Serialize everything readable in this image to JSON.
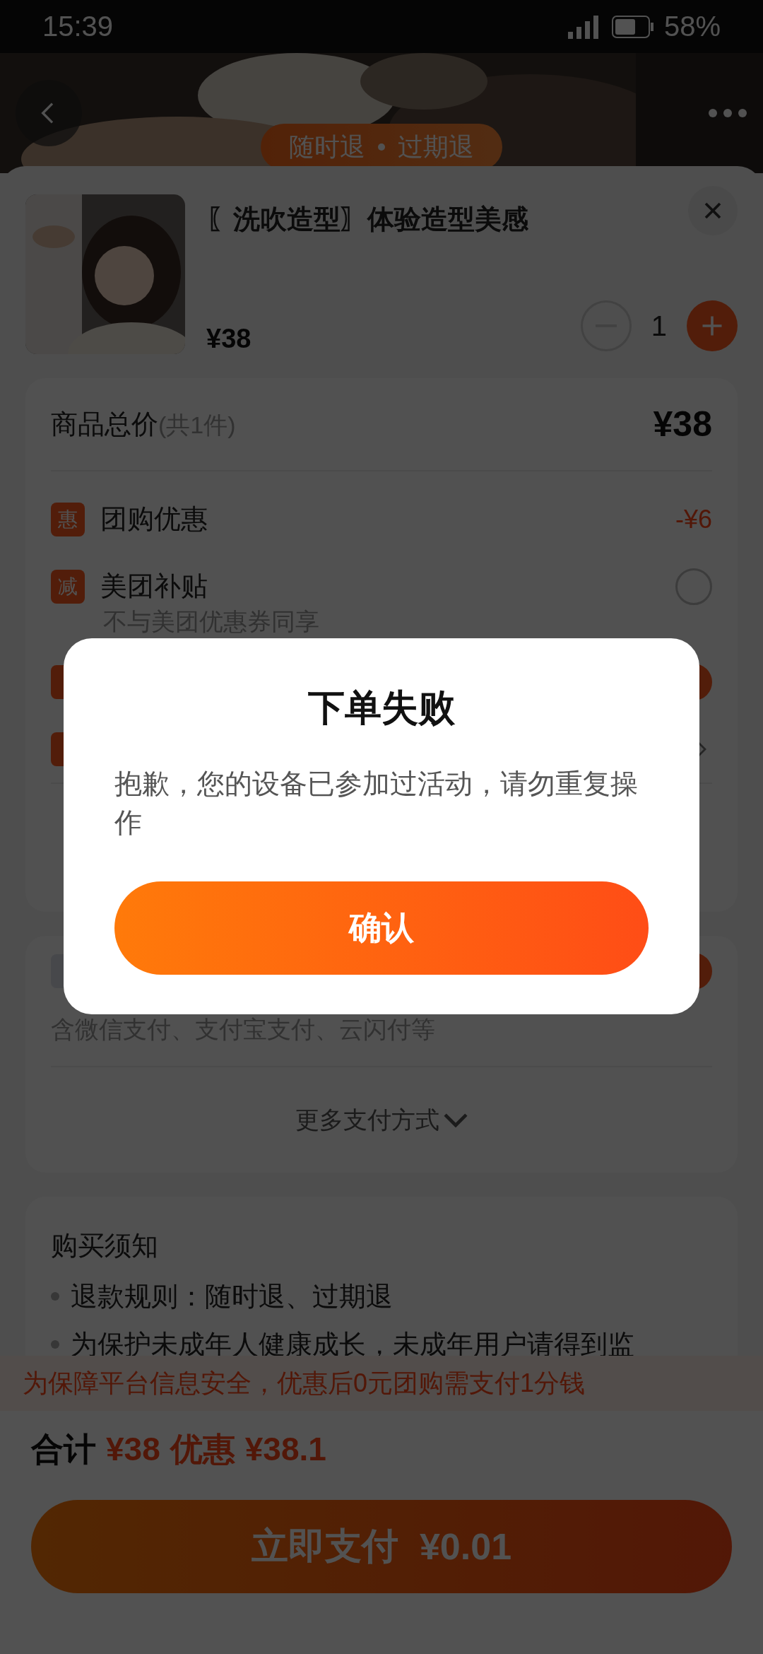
{
  "status_bar": {
    "time": "15:39",
    "battery": "58%"
  },
  "header": {
    "tags": [
      "随时退",
      "过期退"
    ]
  },
  "product": {
    "title": "〖洗吹造型〗体验造型美感",
    "price": "¥38",
    "quantity": "1"
  },
  "price_summary": {
    "label": "商品总价",
    "count": "(共1件)",
    "total": "¥38",
    "discounts": [
      {
        "kind": "amount",
        "badge": "惠",
        "label": "团购优惠",
        "amount": "-¥6"
      },
      {
        "kind": "toggle",
        "badge": "减",
        "label": "美团补贴",
        "note": "不与美团优惠券同享",
        "selected": false
      },
      {
        "kind": "toggle",
        "selected": true
      },
      {
        "kind": "link"
      }
    ]
  },
  "payment": {
    "note": "含微信支付、支付宝支付、云闪付等",
    "selected": true,
    "more": "更多支付方式"
  },
  "notice": {
    "title": "购买须知",
    "items": [
      "退款规则：随时退、过期退",
      "为保护未成年人健康成长，未成年用户请得到监"
    ]
  },
  "banner": "为保障平台信息安全，优惠后0元团购需支付1分钱",
  "footer": {
    "total_label": "合计",
    "total": "¥38",
    "discount_label": "优惠",
    "discount": "¥38.1",
    "pay_label": "立即支付",
    "pay_amount": "¥0.01"
  },
  "dialog": {
    "title": "下单失败",
    "message": "抱歉，您的设备已参加过活动，请勿重复操作",
    "button": "确认"
  }
}
